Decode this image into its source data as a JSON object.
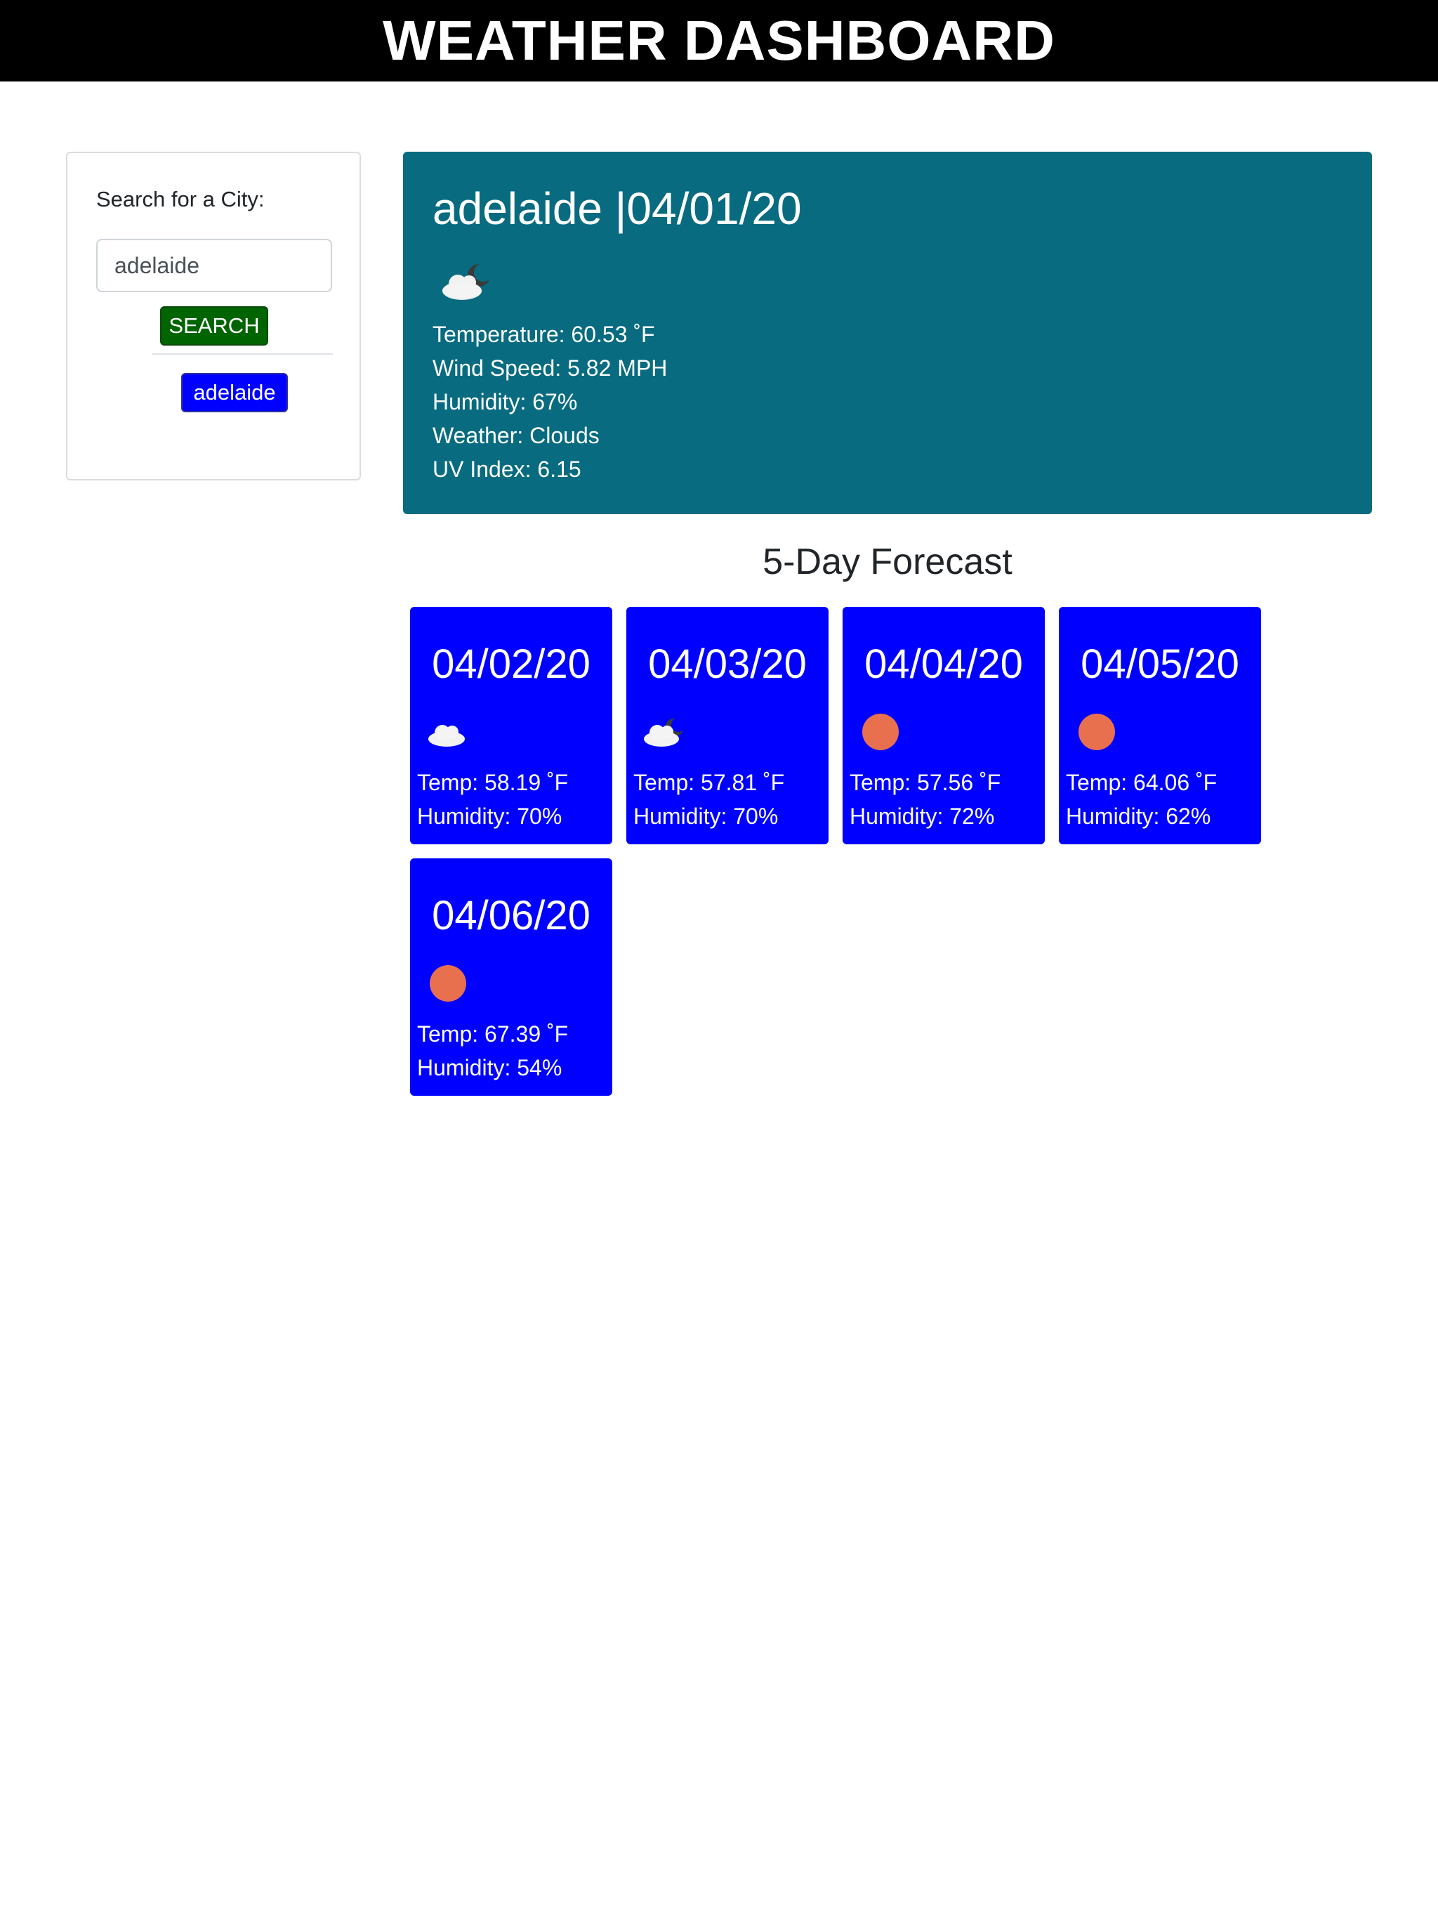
{
  "header": {
    "title": "WEATHER DASHBOARD"
  },
  "search": {
    "label": "Search for a City:",
    "input_value": "adelaide",
    "button_label": "SEARCH",
    "history": [
      "adelaide"
    ]
  },
  "current": {
    "title": "adelaide |04/01/20",
    "icon": "cloud-night-icon",
    "temperature": "Temperature: 60.53 ˚F",
    "wind": "Wind Speed: 5.82 MPH",
    "humidity": "Humidity: 67%",
    "weather": "Weather: Clouds",
    "uv": "UV Index: 6.15",
    "color": "#086b80"
  },
  "forecast": {
    "heading": "5-Day Forecast",
    "color": "#0000ff",
    "days": [
      {
        "date": "04/02/20",
        "icon": "cloud-icon",
        "temp": "Temp: 58.19 ˚F",
        "humidity": "Humidity: 70%"
      },
      {
        "date": "04/03/20",
        "icon": "cloud-night-icon",
        "temp": "Temp: 57.81 ˚F",
        "humidity": "Humidity: 70%"
      },
      {
        "date": "04/04/20",
        "icon": "sun-icon",
        "temp": "Temp: 57.56 ˚F",
        "humidity": "Humidity: 72%"
      },
      {
        "date": "04/05/20",
        "icon": "sun-icon",
        "temp": "Temp: 64.06 ˚F",
        "humidity": "Humidity: 62%"
      },
      {
        "date": "04/06/20",
        "icon": "sun-icon",
        "temp": "Temp: 67.39 ˚F",
        "humidity": "Humidity: 54%"
      }
    ]
  }
}
